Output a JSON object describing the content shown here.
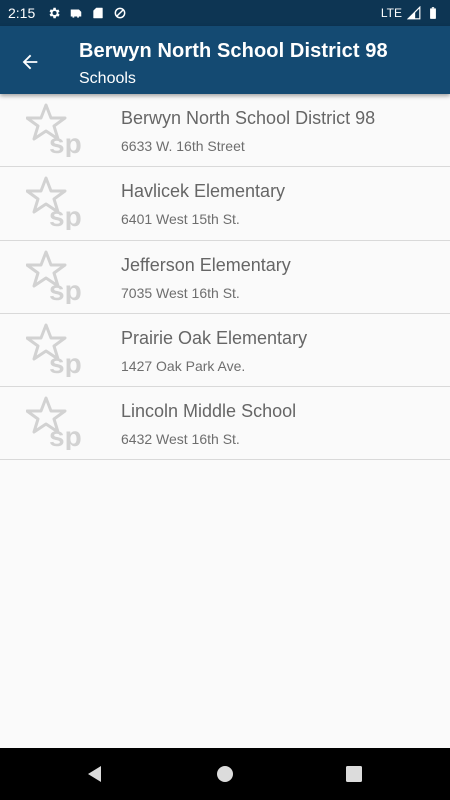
{
  "status_bar": {
    "time": "2:15",
    "network": "LTE",
    "icons": [
      "gear-icon",
      "cast-icon",
      "sd-card-icon",
      "data-saver-icon",
      "signal-icon",
      "battery-icon"
    ]
  },
  "app_bar": {
    "title": "Berwyn North School District 98",
    "subtitle": "Schools",
    "background": "#144a72"
  },
  "schools": [
    {
      "name": "Berwyn North School District 98",
      "address": "6633 W. 16th Street"
    },
    {
      "name": "Havlicek Elementary",
      "address": "6401 West 15th St."
    },
    {
      "name": "Jefferson Elementary",
      "address": "7035 West 16th St."
    },
    {
      "name": "Prairie Oak Elementary",
      "address": "1427 Oak Park Ave."
    },
    {
      "name": "Lincoln Middle School",
      "address": "6432 West 16th St."
    }
  ],
  "logo_text": "sp",
  "nav_bar": {
    "buttons": [
      "back-triangle-icon",
      "home-circle-icon",
      "recents-square-icon"
    ]
  }
}
